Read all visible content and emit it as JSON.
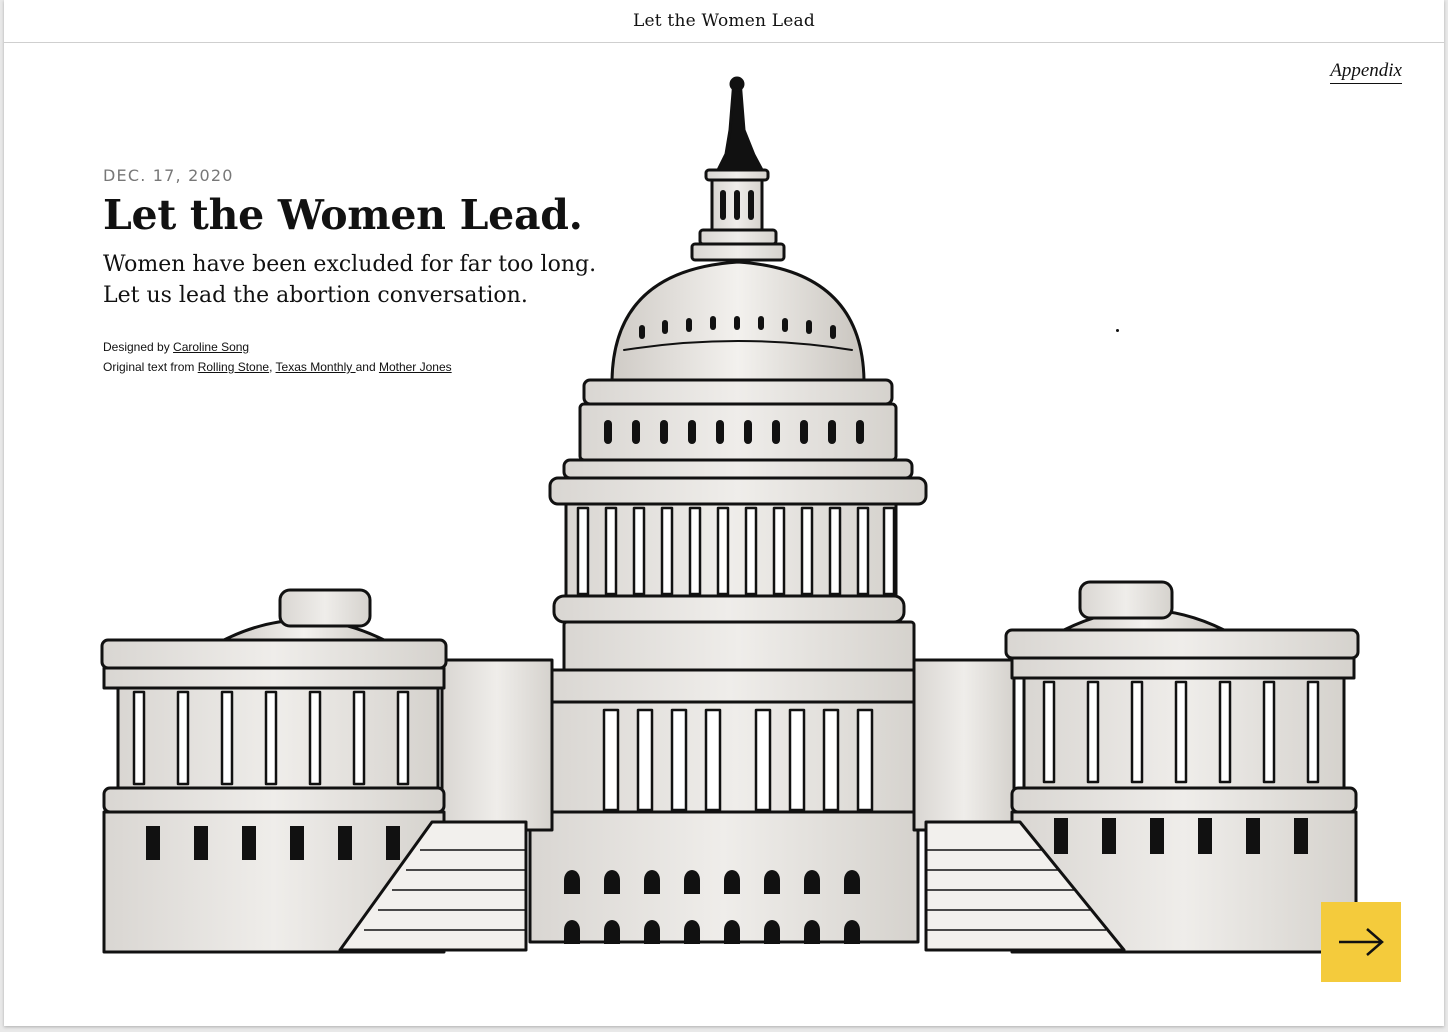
{
  "topbar": {
    "title": "Let the Women Lead"
  },
  "nav": {
    "appendix_label": "Appendix"
  },
  "hero": {
    "date": "DEC. 17, 2020",
    "headline": "Let the Women Lead.",
    "subhead_line1": "Women have been excluded for far too long.",
    "subhead_line2": "Let us lead the abortion conversation."
  },
  "credits": {
    "designed_prefix": "Designed by ",
    "designer": "Caroline Song",
    "original_prefix": "Original text from ",
    "source1": "Rolling Stone",
    "sep": ", ",
    "source2": "Texas Monthly ",
    "and": "and ",
    "source3": "Mother Jones"
  },
  "illustration": {
    "icon": "capitol-building-illustration"
  },
  "next": {
    "icon": "arrow-right-icon"
  },
  "colors": {
    "accent": "#f4cb3c",
    "text": "#111111",
    "muted": "#777777",
    "background": "#ffffff"
  }
}
